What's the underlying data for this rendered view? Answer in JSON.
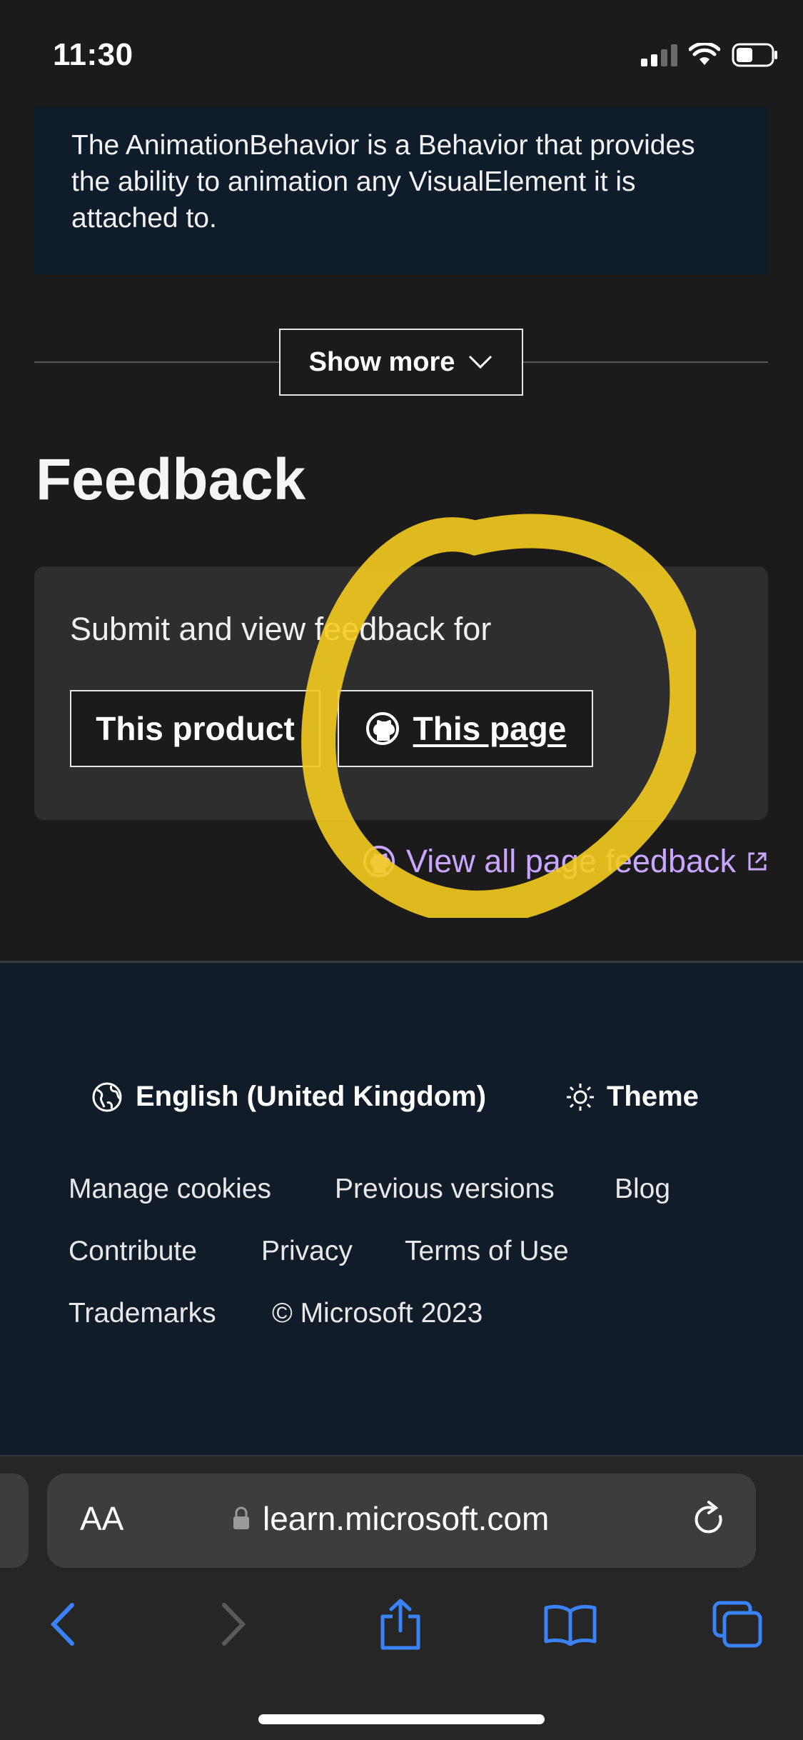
{
  "status_bar": {
    "time": "11:30"
  },
  "description": {
    "text": "The AnimationBehavior is a Behavior that provides the ability to animation any VisualElement it is attached to."
  },
  "show_more": {
    "label": "Show more"
  },
  "feedback": {
    "title": "Feedback",
    "subtitle": "Submit and view feedback for",
    "product_button": "This product",
    "page_button": "This page",
    "view_all": "View all page feedback"
  },
  "annotation": {
    "highlight_color": "#f5cc1f"
  },
  "footer": {
    "language": "English (United Kingdom)",
    "theme": "Theme",
    "links": [
      "Manage cookies",
      "Previous versions",
      "Blog",
      "Contribute",
      "Privacy",
      "Terms of Use",
      "Trademarks",
      "© Microsoft 2023"
    ]
  },
  "browser": {
    "text_size_label": "AA",
    "url": "learn.microsoft.com",
    "accent_color": "#3a82f7"
  }
}
